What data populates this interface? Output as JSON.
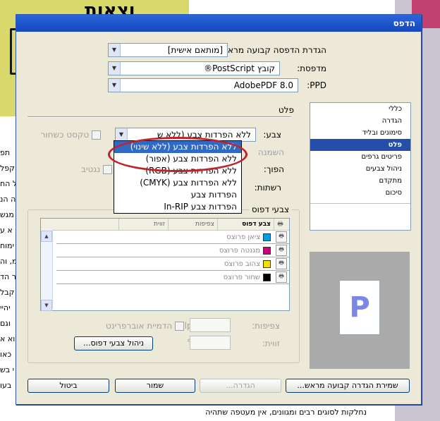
{
  "background": {
    "top_heading": "וצאות",
    "left_fragments": [
      "תפ",
      "קפל",
      "ל הח",
      "ה הנ",
      "מגש",
      "א ע",
      "ימוח",
      "מ, וה",
      "ר הד",
      "קבל",
      "יהיי",
      "וגם",
      "וא א",
      "כאו",
      "י בש",
      "בעו"
    ],
    "bottom_text": "נחלקות לסוגים רבים ומגוונים, אין מעטפה שתהיה"
  },
  "dialog": {
    "title": "הדפס",
    "preset_label": "הגדרת הדפסה קבועה מראש:",
    "preset_value": "[מותאם אישית]",
    "printer_label": "מדפסת:",
    "printer_value": "קובץ PostScript®",
    "ppd_label": "PPD:",
    "ppd_value": "AdobePDF 8.0",
    "nav_items": [
      "כללי",
      "הגדרה",
      "סימונים ובליד",
      "פלט",
      "פריטים גרפים",
      "ניהול צבעים",
      "מתקדם",
      "סיכום"
    ],
    "nav_selected": "פלט",
    "section_title": "פלט",
    "color_label": "צבע:",
    "color_value": "ללא הפרדות צבע (ללא ש",
    "trapping_label": "השמנה",
    "flip_label": "הפוך:",
    "screening_label": "רשתות:",
    "text_black_label": "טקסט כשחור",
    "negative_label": "נגטיב",
    "dropdown_options": [
      "ללא הפרדות צבע (ללא שינוי)",
      "ללא הפרדות צבע (אפור)",
      "ללא הפרדות צבע (RGB)",
      "ללא הפרדות צבע (CMYK)",
      "הפרדות צבע",
      "הפרדות צבע In-RIP"
    ],
    "inks_group_title": "צבעי דפוס",
    "inks_headers": [
      "צבע דפוס",
      "צפיפות",
      "זווית"
    ],
    "inks": [
      {
        "name": "ציאן פרוצס",
        "color": "#00a0e0"
      },
      {
        "name": "מגנטה פרוצס",
        "color": "#d0007a"
      },
      {
        "name": "צהוב פרוצס",
        "color": "#f0e000"
      },
      {
        "name": "שחור פרוצס",
        "color": "#000000"
      }
    ],
    "simulate_overprint_label": "הדמיית אוברפרינט",
    "frequency_label": "צפיפות:",
    "frequency_unit": "lpi",
    "angle_label": "זווית:",
    "angle_unit": "°",
    "ink_manager_button": "ניהול צבעי דפוס...",
    "preview_letter": "P",
    "buttons": {
      "save_preset": "שמירת הגדרה קבועה מראש...",
      "setup": "הגדרה...",
      "save": "שמור",
      "cancel": "ביטול"
    }
  }
}
